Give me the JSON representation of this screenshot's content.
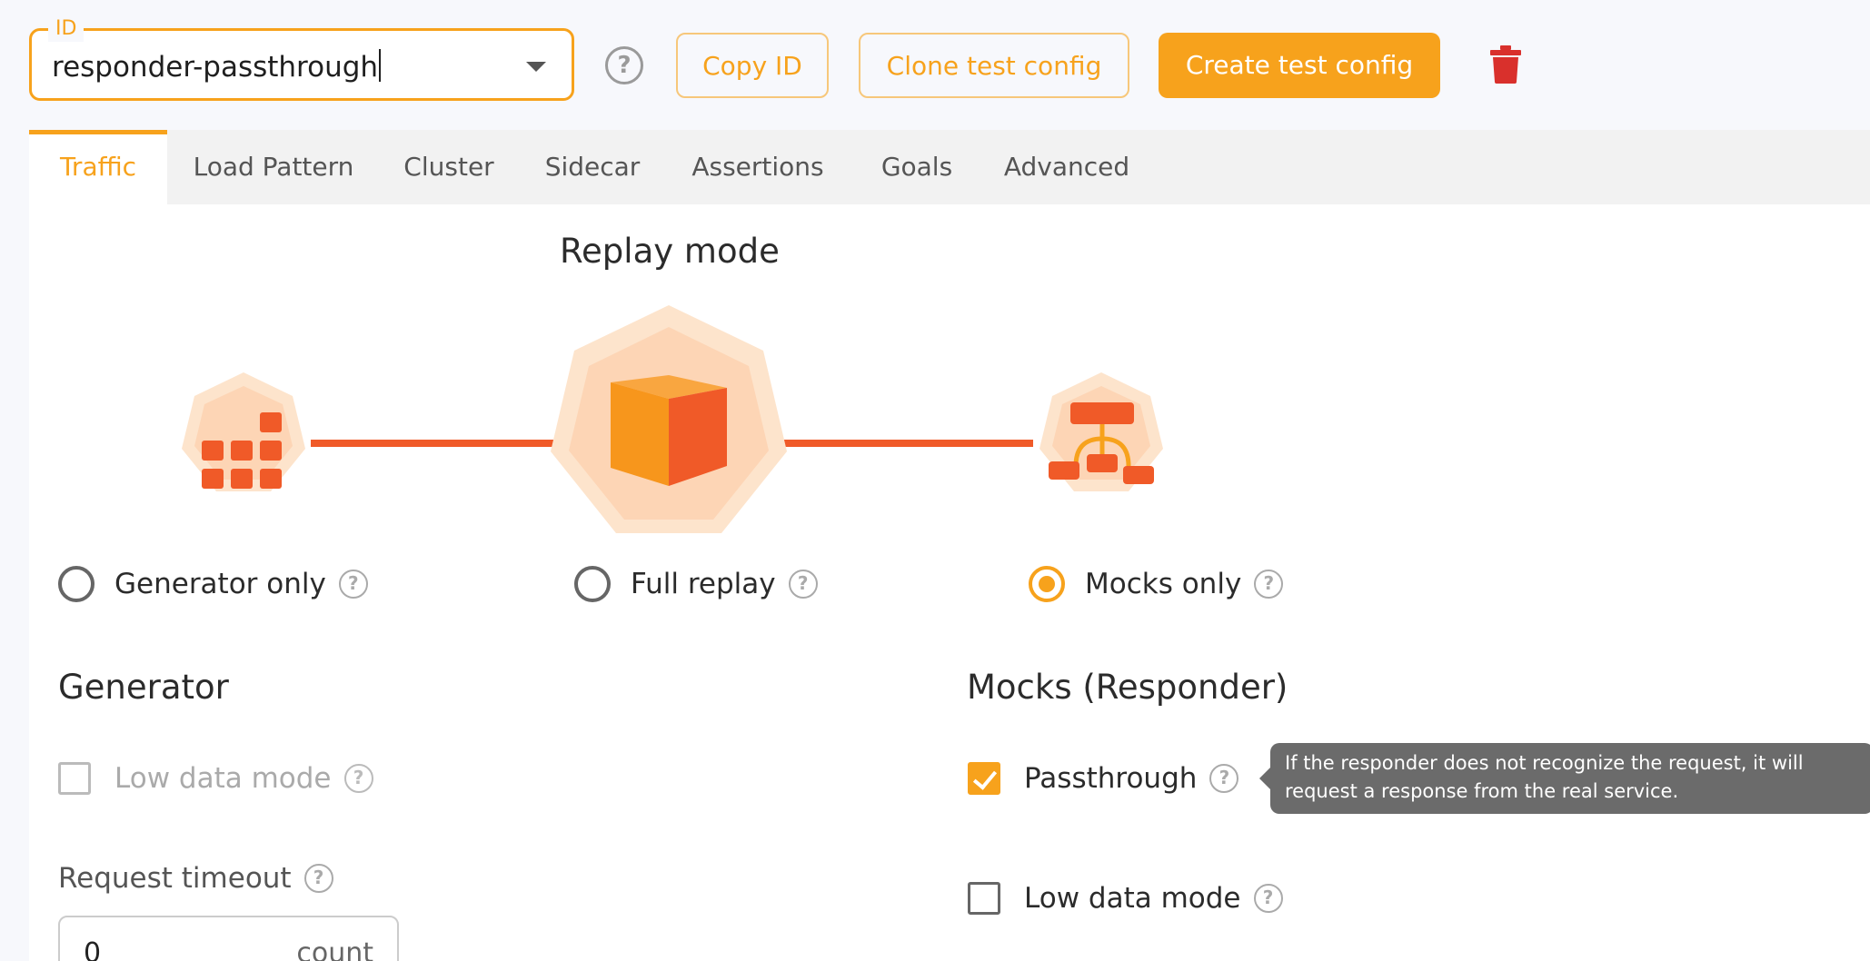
{
  "id_field": {
    "label": "ID",
    "value": "responder-passthrough"
  },
  "toolbar": {
    "copy_label": "Copy ID",
    "clone_label": "Clone test config",
    "create_label": "Create test config"
  },
  "tabs": [
    {
      "label": "Traffic",
      "active": true
    },
    {
      "label": "Load Pattern"
    },
    {
      "label": "Cluster"
    },
    {
      "label": "Sidecar"
    },
    {
      "label": "Assertions"
    },
    {
      "label": "Goals"
    },
    {
      "label": "Advanced"
    }
  ],
  "replay": {
    "title": "Replay mode",
    "options": [
      {
        "label": "Generator only",
        "selected": false
      },
      {
        "label": "Full replay",
        "selected": false
      },
      {
        "label": "Mocks only",
        "selected": true
      }
    ]
  },
  "generator": {
    "title": "Generator",
    "low_data_mode": {
      "label": "Low data mode",
      "checked": false,
      "disabled": true
    },
    "request_timeout": {
      "label": "Request timeout",
      "value": "0",
      "unit": "count"
    }
  },
  "mocks": {
    "title": "Mocks (Responder)",
    "passthrough": {
      "label": "Passthrough",
      "checked": true
    },
    "passthrough_tooltip": "If the responder does not recognize the request, it will request a response from the real service.",
    "low_data_mode": {
      "label": "Low data mode",
      "checked": false
    }
  },
  "colors": {
    "accent": "#f7a21c",
    "accent_dark": "#f05a28",
    "danger": "#d9302c",
    "hex_light": "#fde4cc",
    "hex_mid": "#fdd5b5"
  },
  "icons": {
    "help": "question-circle-icon",
    "dropdown": "chevron-down-icon",
    "delete": "trash-icon",
    "generator": "grid-blocks-icon",
    "full_replay": "cube-icon",
    "mocks": "hierarchy-icon"
  }
}
